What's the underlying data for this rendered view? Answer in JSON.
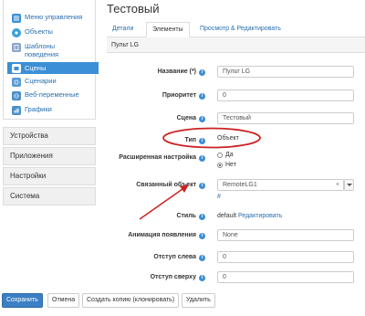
{
  "sidebar": {
    "items": [
      {
        "label": "Меню управления",
        "icon": "list-icon"
      },
      {
        "label": "Объекты",
        "icon": "objects-icon"
      },
      {
        "label": "Шаблоны",
        "label2": "поведения",
        "icon": "templates-icon"
      },
      {
        "label": "Сцены",
        "icon": "scenes-icon"
      },
      {
        "label": "Сценарии",
        "icon": "scripts-icon"
      },
      {
        "label": "Веб-переменные",
        "icon": "web-vars-icon"
      },
      {
        "label": "Графики",
        "icon": "charts-icon"
      }
    ],
    "sections": [
      "Устройства",
      "Приложения",
      "Настройки",
      "Система"
    ]
  },
  "page": {
    "title": "Тестовый"
  },
  "tabs": [
    "Детали",
    "Элементы",
    "Просмотр & Редактировать"
  ],
  "panel": {
    "title": "Пульт LG"
  },
  "form": {
    "name_label": "Название (*)",
    "name_value": "Пульт LG",
    "priority_label": "Приоритет",
    "priority_value": "0",
    "scene_label": "Сцена",
    "scene_value": "Тестовый",
    "type_label": "Тип",
    "type_value": "Объект",
    "advanced_label": "Расширенная настройка",
    "advanced_yes": "Да",
    "advanced_no": "Нет",
    "linked_label": "Связанный объект",
    "linked_value": "RemoteLG1",
    "linked_clear": "×",
    "hash": "#",
    "style_label": "Стиль",
    "style_value": "default",
    "style_edit": "Редактировать",
    "anim_label": "Анимация появления",
    "anim_value": "None",
    "left_label": "Отступ слева",
    "left_value": "0",
    "top_label": "Отступ сверху",
    "top_value": "0"
  },
  "buttons": {
    "save": "Сохранить",
    "cancel": "Отмена",
    "clone": "Создать копию (клонировать)",
    "delete": "Удалить"
  },
  "colors": {
    "accent": "#3b8fd6",
    "annotation": "#cc2222",
    "link": "#2a6fb0"
  }
}
